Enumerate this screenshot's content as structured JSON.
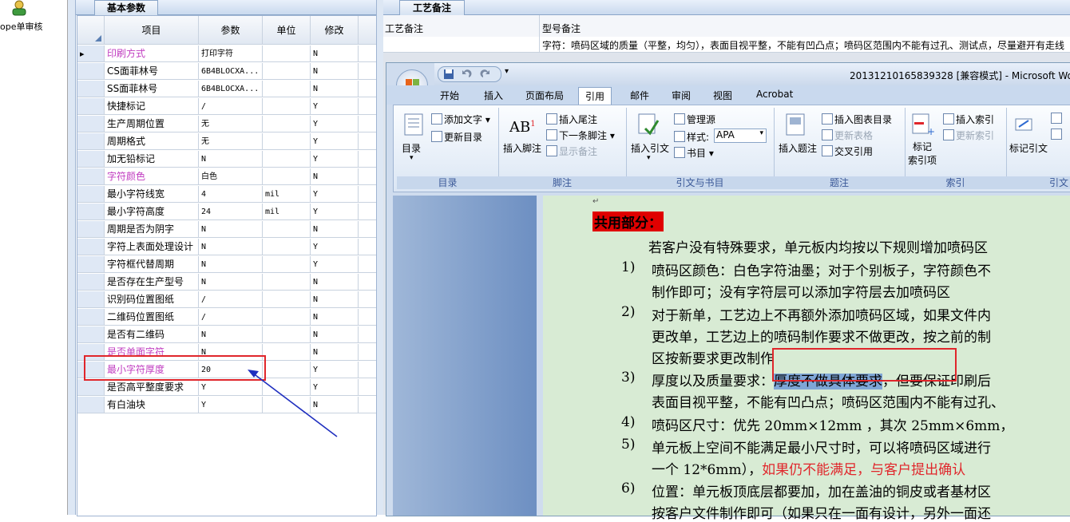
{
  "nav": {
    "label": "ope单审核",
    "icon": "user-check-icon"
  },
  "left_panel": {
    "tab_label": "基本参数",
    "columns": [
      "项目",
      "参数",
      "单位",
      "修改"
    ],
    "rows": [
      {
        "name": "印刷方式",
        "param": "打印字符",
        "unit": "",
        "mod": "N",
        "highlight": true,
        "current": true
      },
      {
        "name": "CS面菲林号",
        "param": "6B4BLOCXA...",
        "unit": "",
        "mod": "N"
      },
      {
        "name": "SS面菲林号",
        "param": "6B4BLOCXA...",
        "unit": "",
        "mod": "N"
      },
      {
        "name": "快捷标记",
        "param": "/",
        "unit": "",
        "mod": "Y"
      },
      {
        "name": "生产周期位置",
        "param": "无",
        "unit": "",
        "mod": "Y"
      },
      {
        "name": "周期格式",
        "param": "无",
        "unit": "",
        "mod": "Y"
      },
      {
        "name": "加无铅标记",
        "param": "N",
        "unit": "",
        "mod": "Y"
      },
      {
        "name": "字符颜色",
        "param": "白色",
        "unit": "",
        "mod": "N",
        "highlight": true
      },
      {
        "name": "最小字符线宽",
        "param": "4",
        "unit": "mil",
        "mod": "Y"
      },
      {
        "name": "最小字符高度",
        "param": "24",
        "unit": "mil",
        "mod": "Y"
      },
      {
        "name": "周期是否为阴字",
        "param": "N",
        "unit": "",
        "mod": "N"
      },
      {
        "name": "字符上表面处理设计",
        "param": "N",
        "unit": "",
        "mod": "Y"
      },
      {
        "name": "字符框代替周期",
        "param": "N",
        "unit": "",
        "mod": "Y"
      },
      {
        "name": "是否存在生产型号",
        "param": "N",
        "unit": "",
        "mod": "N"
      },
      {
        "name": "识别码位置图纸",
        "param": "/",
        "unit": "",
        "mod": "N"
      },
      {
        "name": "二维码位置图纸",
        "param": "/",
        "unit": "",
        "mod": "N"
      },
      {
        "name": "是否有二维码",
        "param": "N",
        "unit": "",
        "mod": "N"
      },
      {
        "name": "是否单面字符",
        "param": "N",
        "unit": "",
        "mod": "N",
        "highlight": true
      },
      {
        "name": "最小字符厚度",
        "param": "20",
        "unit": "",
        "mod": "Y",
        "highlight": true
      },
      {
        "name": "是否高平整度要求",
        "param": "Y",
        "unit": "",
        "mod": "Y"
      },
      {
        "name": "有白油块",
        "param": "Y",
        "unit": "",
        "mod": "N"
      }
    ]
  },
  "right_panel": {
    "tab_label": "工艺备注",
    "col1_header": "工艺备注",
    "col2_header": "型号备注",
    "remark_text": "字符：喷码区域的质量（平整，均匀），表面目视平整，不能有凹凸点；喷码区范围内不能有过孔、测试点，尽量避开有走线"
  },
  "word": {
    "title": "20131210165839328 [兼容模式] - Microsoft Wor",
    "tabs": [
      "开始",
      "插入",
      "页面布局",
      "引用",
      "邮件",
      "审阅",
      "视图",
      "Acrobat"
    ],
    "active_tab": "引用",
    "groups": {
      "toc": {
        "label": "目录",
        "big": "目录",
        "items": [
          "添加文字",
          "更新目录"
        ]
      },
      "footnote": {
        "label": "脚注",
        "big": "插入脚注",
        "items": [
          "插入尾注",
          "下一条脚注",
          "显示备注"
        ]
      },
      "citation": {
        "label": "引文与书目",
        "big": "插入引文",
        "items": [
          "管理源",
          "样式:",
          "APA",
          "书目"
        ]
      },
      "caption": {
        "label": "题注",
        "big": "插入题注",
        "items": [
          "插入图表目录",
          "更新表格",
          "交叉引用"
        ]
      },
      "index": {
        "label": "索引",
        "big1": "标记",
        "big2": "索引项",
        "items": [
          "插入索引",
          "更新索引"
        ]
      },
      "toa": {
        "label": "引文",
        "big": "标记引文"
      }
    },
    "doc": {
      "heading": "共用部分：",
      "intro": "若客户没有特殊要求，单元板内均按以下规则增加喷码区",
      "items": [
        {
          "num": "1)",
          "lines": [
            "喷码区颜色：白色字符油墨；对于个别板子，字符颜色不",
            "制作即可；没有字符层可以添加字符层去加喷码区"
          ]
        },
        {
          "num": "2)",
          "lines": [
            "对于新单，工艺边上不再额外添加喷码区域，如果文件内",
            "更改单，工艺边上的喷码制作要求不做更改，按之前的制",
            "区按新要求更改制作"
          ]
        },
        {
          "num": "3)",
          "lines": [
            "厚度以及质量要求：",
            "厚度不做具体要求",
            "，但要保证印刷后",
            "表面目视平整，不能有凹凸点；喷码区范围内不能有过孔、"
          ]
        },
        {
          "num": "4)",
          "lines": [
            "喷码区尺寸：优先 20mm×12mm ，其次 25mm×6mm，"
          ]
        },
        {
          "num": "5)",
          "lines": [
            "单元板上空间不能满足最小尺寸时，可以将喷码区域进行",
            "一个 12*6mm），",
            "如果仍不能满足，与客户提出确认"
          ]
        },
        {
          "num": "6)",
          "lines": [
            "位置：单元板顶底层都要加，加在盖油的铜皮或者基材区",
            "按客户文件制作即可（如果只在一面有设计，另外一面还"
          ]
        }
      ]
    }
  }
}
